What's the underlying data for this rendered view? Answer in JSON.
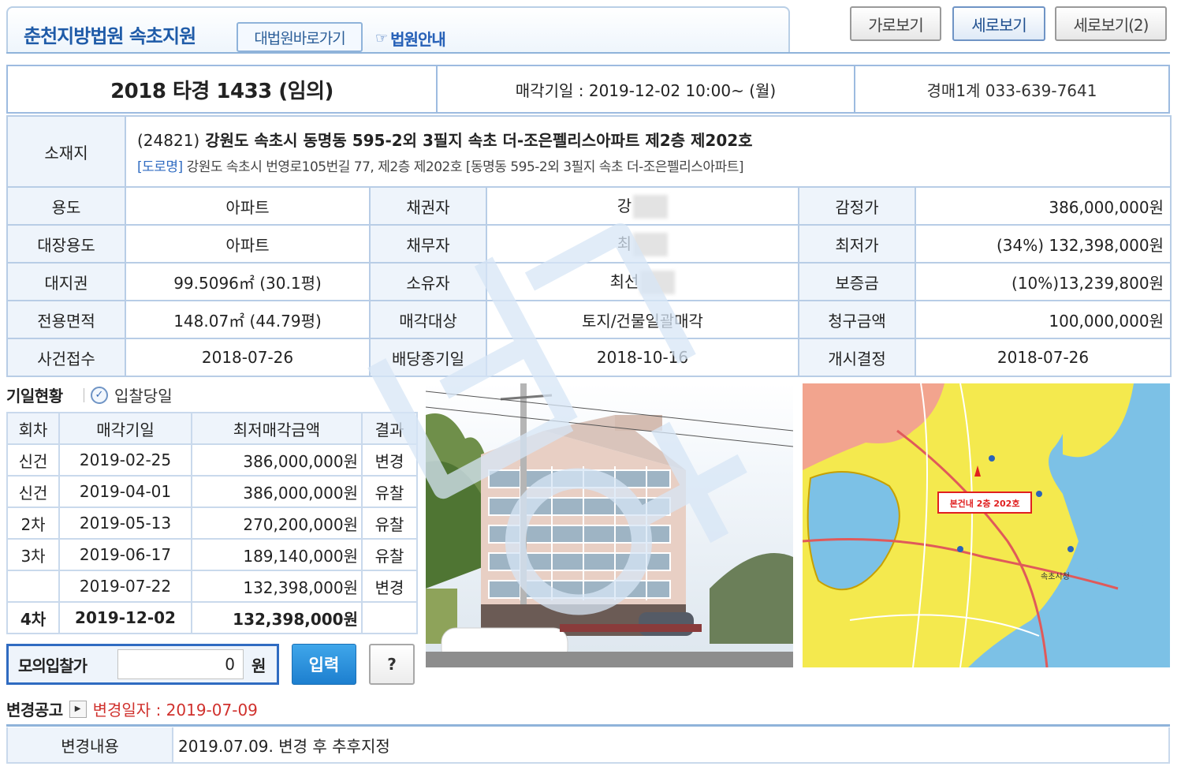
{
  "header": {
    "court_name": "춘천지방법원 속초지원",
    "supreme_court_link": "대법원바로가기",
    "court_guide": "법원안내",
    "view_buttons": [
      "가로보기",
      "세로보기",
      "세로보기(2)"
    ],
    "active_view": "세로보기"
  },
  "case": {
    "case_number": "2018 타경 1433 (임의)",
    "sale_date": "매각기일 : 2019-12-02 10:00~ (월)",
    "department": "경매1계 033-639-7641"
  },
  "property": {
    "address_label": "소재지",
    "address_zip": "(24821)",
    "address_main": "강원도 속초시 동명동 595-2외 3필지 속초 더-조은펠리스아파트 제2층 제202호",
    "road_tag": "[도로명]",
    "road_address": "강원도 속초시 번영로105번길 77, 제2층 제202호 [동명동 595-2외 3필지 속초 더-조은펠리스아파트]",
    "rows": [
      {
        "l1": "용도",
        "v1": "아파트",
        "l2": "채권자",
        "v2": "강",
        "l3": "감정가",
        "v3": "386,000,000원"
      },
      {
        "l1": "대장용도",
        "v1": "아파트",
        "l2": "채무자",
        "v2": "최",
        "l3": "최저가",
        "v3": "(34%) 132,398,000원"
      },
      {
        "l1": "대지권",
        "v1": "99.5096㎡ (30.1평)",
        "l2": "소유자",
        "v2": "최선",
        "l3": "보증금",
        "v3": "(10%)13,239,800원"
      },
      {
        "l1": "전용면적",
        "v1": "148.07㎡ (44.79평)",
        "l2": "매각대상",
        "v2": "토지/건물일괄매각",
        "l3": "청구금액",
        "v3": "100,000,000원"
      },
      {
        "l1": "사건접수",
        "v1": "2018-07-26",
        "l2": "배당종기일",
        "v2": "2018-10-16",
        "l3": "개시결정",
        "v3": "2018-07-26"
      }
    ]
  },
  "schedule": {
    "title": "기일현황",
    "legend": "입찰당일",
    "headers": [
      "회차",
      "매각기일",
      "최저매각금액",
      "결과"
    ],
    "rows": [
      {
        "round": "신건",
        "date": "2019-02-25",
        "amount": "386,000,000원",
        "result": "변경"
      },
      {
        "round": "신건",
        "date": "2019-04-01",
        "amount": "386,000,000원",
        "result": "유찰"
      },
      {
        "round": "2차",
        "date": "2019-05-13",
        "amount": "270,200,000원",
        "result": "유찰"
      },
      {
        "round": "3차",
        "date": "2019-06-17",
        "amount": "189,140,000원",
        "result": "유찰"
      },
      {
        "round": "",
        "date": "2019-07-22",
        "amount": "132,398,000원",
        "result": "변경"
      },
      {
        "round": "4차",
        "date": "2019-12-02",
        "amount": "132,398,000원",
        "result": ""
      }
    ]
  },
  "mock_bid": {
    "label": "모의입찰가",
    "value": "0",
    "unit": "원",
    "enter": "입력",
    "help": "?"
  },
  "map": {
    "marker_label": "본건내 2층 202호",
    "city_hall": "속초시청"
  },
  "change": {
    "title": "변경공고",
    "date_text": "변경일자 : 2019-07-09",
    "content_label": "변경내용",
    "content": "2019.07.09. 변경 후 추후지정"
  },
  "colors": {
    "accent_blue": "#2f6bc1",
    "border_blue": "#9dbbe0",
    "label_bg": "#eef4fb",
    "red": "#d0312d"
  }
}
